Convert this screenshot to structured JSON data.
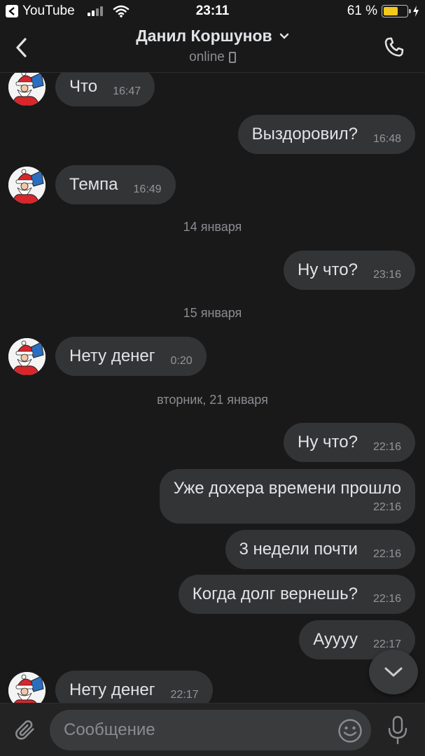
{
  "status_bar": {
    "back_app": "YouTube",
    "time": "23:11",
    "battery_text": "61 %",
    "battery_level": 0.61
  },
  "header": {
    "contact_name": "Данил Коршунов",
    "contact_status": "online"
  },
  "messages": [
    {
      "dir": "in",
      "text": "Что",
      "time": "16:47"
    },
    {
      "dir": "out",
      "text": "Выздоровил?",
      "time": "16:48"
    },
    {
      "dir": "in",
      "text": "Темпа",
      "time": "16:49"
    },
    {
      "date": "14 января"
    },
    {
      "dir": "out",
      "text": "Ну что?",
      "time": "23:16"
    },
    {
      "date": "15 января"
    },
    {
      "dir": "in",
      "text": "Нету денег",
      "time": "0:20"
    },
    {
      "date": "вторник, 21 января"
    },
    {
      "dir": "out",
      "text": "Ну что?",
      "time": "22:16"
    },
    {
      "dir": "out",
      "text": "Уже дохера времени прошло",
      "time": "22:16"
    },
    {
      "dir": "out",
      "text": "3 недели почти",
      "time": "22:16"
    },
    {
      "dir": "out",
      "text": "Когда долг вернешь?",
      "time": "22:16"
    },
    {
      "dir": "out",
      "text": "Ауууу",
      "time": "22:17"
    },
    {
      "dir": "in",
      "text": "Нету денег",
      "time": "22:17"
    }
  ],
  "composer": {
    "placeholder": "Сообщение"
  },
  "colors": {
    "background": "#19191a",
    "bubble": "#333436",
    "battery": "#f4c81c"
  }
}
